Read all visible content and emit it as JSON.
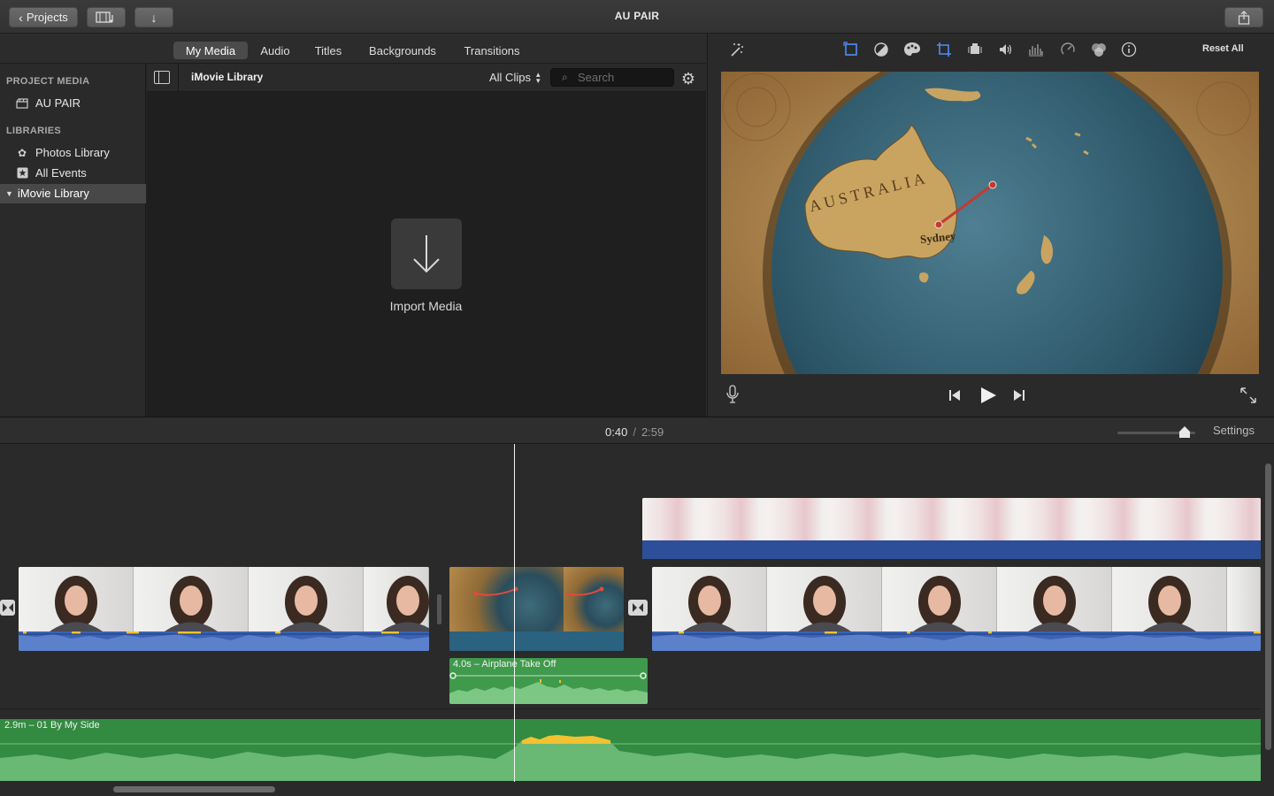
{
  "titlebar": {
    "projects_label": "Projects",
    "app_title": "AU PAIR"
  },
  "browser_tabs": [
    {
      "label": "My Media",
      "active": true
    },
    {
      "label": "Audio",
      "active": false
    },
    {
      "label": "Titles",
      "active": false
    },
    {
      "label": "Backgrounds",
      "active": false
    },
    {
      "label": "Transitions",
      "active": false
    }
  ],
  "sidebar": {
    "project_media_heading": "PROJECT MEDIA",
    "project_item": "AU PAIR",
    "libraries_heading": "LIBRARIES",
    "photos_library": "Photos Library",
    "all_events": "All Events",
    "imovie_library": "iMovie Library"
  },
  "library_bar": {
    "title": "iMovie Library",
    "filter": "All Clips",
    "search_placeholder": "Search"
  },
  "media": {
    "import_label": "Import Media"
  },
  "viewer": {
    "reset_all": "Reset All",
    "map_label_country": "AUSTRALIA",
    "map_label_city": "Sydney"
  },
  "timeline": {
    "current_time": "0:40",
    "separator": "/",
    "total_time": "2:59",
    "settings_label": "Settings",
    "zoom_level": 0.86,
    "sound_clip_label": "4.0s – Airplane Take Off",
    "music_clip_label": "2.9m – 01 By My Side"
  },
  "colors": {
    "accent": "#3b82f6",
    "video_audio_blue": "#3b62b4",
    "audio_green": "#3f9a4c",
    "music_green": "#338a41",
    "peak_yellow": "#f2c230"
  }
}
